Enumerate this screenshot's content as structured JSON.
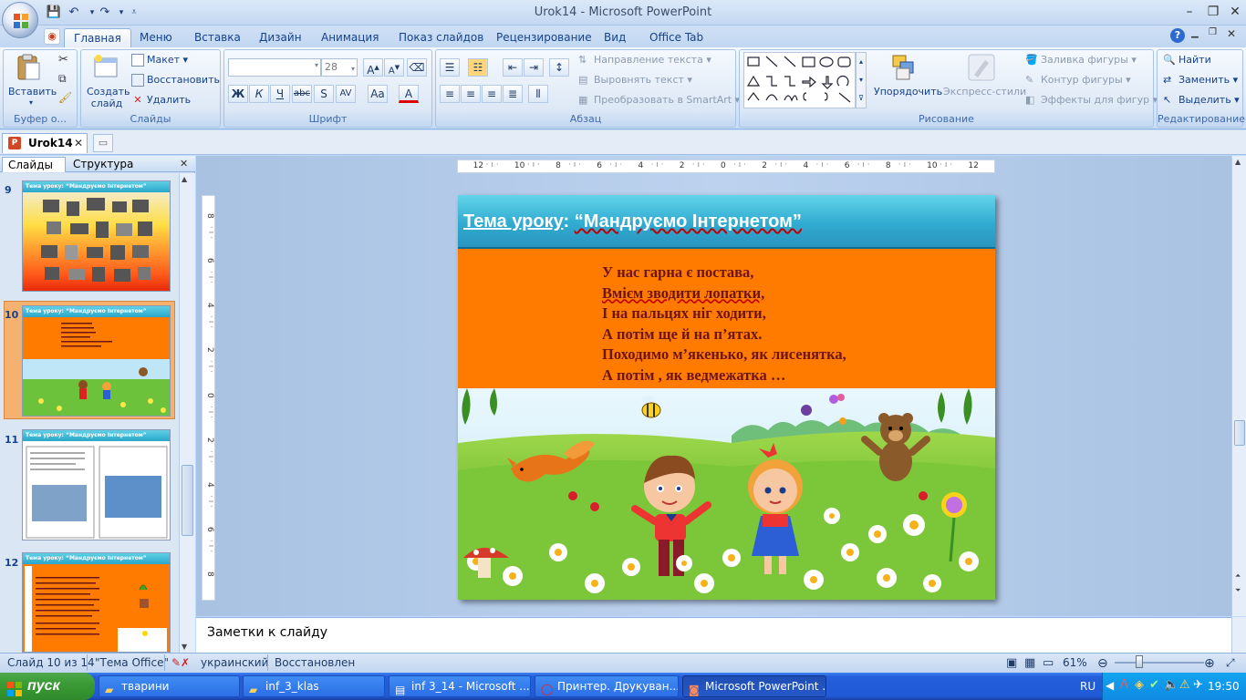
{
  "window": {
    "title": "Urok14 - Microsoft PowerPoint",
    "qat_icons": [
      "save-icon",
      "undo-icon",
      "redo-icon",
      "customize-icon"
    ]
  },
  "ribbon": {
    "tabs": [
      "Главная",
      "Меню",
      "Вставка",
      "Дизайн",
      "Анимация",
      "Показ слайдов",
      "Рецензирование",
      "Вид",
      "Office Tab"
    ],
    "active_tab": "Главная",
    "clipboard": {
      "group": "Буфер о...",
      "paste": "Вставить"
    },
    "slides": {
      "group": "Слайды",
      "new_slide": "Создать слайд",
      "layout": "Макет",
      "reset": "Восстановить",
      "delete": "Удалить"
    },
    "font": {
      "group": "Шрифт",
      "font_name": "",
      "font_size": "28",
      "bold": "Ж",
      "italic": "К",
      "underline": "Ч",
      "strike": "abc",
      "shadow": "S",
      "spacing": "AV",
      "case": "Aa",
      "color": "A"
    },
    "paragraph": {
      "group": "Абзац",
      "text_direction": "Направление текста",
      "align_text": "Выровнять текст",
      "smartart": "Преобразовать в SmartArt"
    },
    "drawing": {
      "group": "Рисование",
      "arrange": "Упорядочить",
      "quick_styles": "Экспресс-стили",
      "fill": "Заливка фигуры",
      "outline": "Контур фигуры",
      "effects": "Эффекты для фигур"
    },
    "editing": {
      "group": "Редактирование",
      "find": "Найти",
      "replace": "Заменить",
      "select": "Выделить"
    }
  },
  "doc_tab": {
    "name": "Urok14"
  },
  "left_panel": {
    "tabs": [
      "Слайды",
      "Структура"
    ],
    "slides": [
      {
        "num": "9",
        "title": "Тема уроку: “Мандруємо Інтернетом”"
      },
      {
        "num": "10",
        "title": "Тема уроку: “Мандруємо Інтернетом”",
        "selected": true
      },
      {
        "num": "11",
        "title": "Тема уроку: “Мандруємо Інтернетом”"
      },
      {
        "num": "12",
        "title": "Тема уроку: “Мандруємо Інтернетом”"
      }
    ]
  },
  "rulers": {
    "h_ticks": [
      "12",
      "10",
      "8",
      "6",
      "4",
      "2",
      "0",
      "2",
      "4",
      "6",
      "8",
      "10",
      "12"
    ],
    "v_ticks": [
      "8",
      "6",
      "4",
      "2",
      "0",
      "2",
      "4",
      "6",
      "8"
    ]
  },
  "slide": {
    "title_label": "Тема уроку",
    "title_colon": ":",
    "title_quote": "“Мандруємо Інтернетом”",
    "poem": [
      "У нас гарна є постава,",
      "Вмієм зводити лопатки,",
      "І на пальцях ніг ходити,",
      "А потім ще й на п’ятах.",
      "Походимо м’якенько, як лисенятка,",
      "А потім , як ведмежатка …"
    ]
  },
  "notes": {
    "placeholder": "Заметки к слайду"
  },
  "status": {
    "slide": "Слайд 10 из 14",
    "theme": "\"Тема Office\"",
    "language": "украинский",
    "state": "Восстановлен",
    "zoom": "61%"
  },
  "taskbar": {
    "start": "пуск",
    "tasks": [
      "тварини",
      "inf_3_klas",
      "inf 3_14 - Microsoft ...",
      "Принтер. Друкуван...",
      "Microsoft PowerPoint ..."
    ],
    "lang": "RU",
    "clock": "19:50"
  },
  "colors": {
    "slide_bg": "#ff7b00",
    "header": "#31abd1",
    "poem_text": "#6d1414"
  }
}
